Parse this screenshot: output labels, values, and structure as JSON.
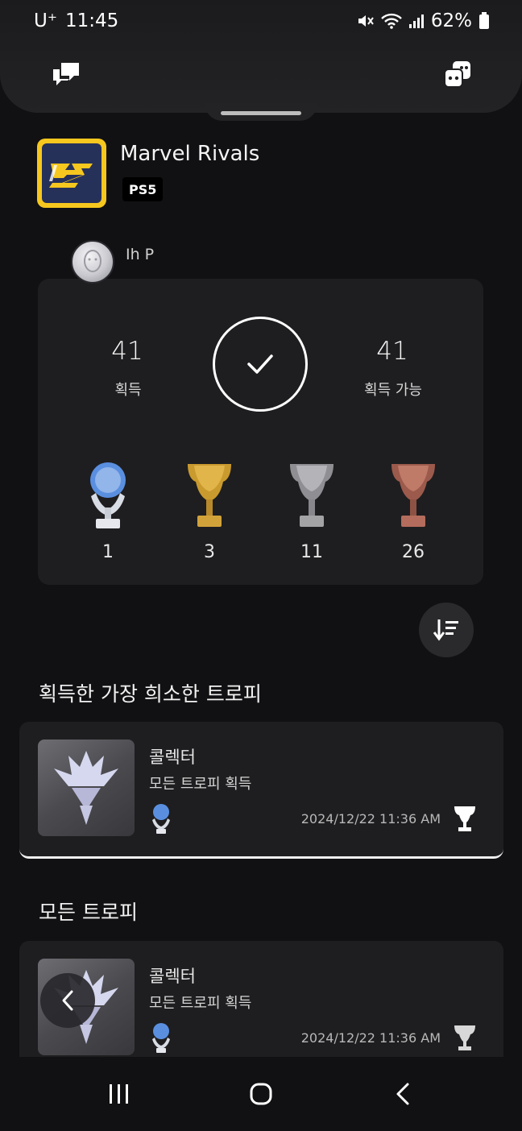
{
  "status_bar": {
    "carrier": "U⁺",
    "time": "11:45",
    "battery": "62%",
    "icons": [
      "mute-icon",
      "wifi-icon",
      "signal-icon",
      "battery-icon"
    ]
  },
  "top_panel": {
    "left_icon": "chat-bubbles-icon",
    "right_icon": "game-controllers-icon"
  },
  "game": {
    "title": "Marvel Rivals",
    "platform": "PS5",
    "icon_colors": {
      "frame": "#f6c71e",
      "background": "#26315a"
    }
  },
  "user": {
    "name": "Ih P"
  },
  "summary": {
    "earned_count": "41",
    "earned_label": "획득",
    "available_count": "41",
    "available_label": "획득 가능",
    "completion_icon": "checkmark-icon"
  },
  "trophy_counts": [
    {
      "grade": "platinum",
      "count": "1",
      "color": "#a9c4ee"
    },
    {
      "grade": "gold",
      "count": "3",
      "color": "#c99a2e"
    },
    {
      "grade": "silver",
      "count": "11",
      "color": "#a3a3a6"
    },
    {
      "grade": "bronze",
      "count": "26",
      "color": "#b46c5c"
    }
  ],
  "sort_button": {
    "icon": "sort-descending-icon"
  },
  "rarest_section": {
    "title": "획득한 가장 희소한 트로피",
    "trophy": {
      "name": "콜렉터",
      "description": "모든 트로피 획득",
      "grade": "platinum",
      "date": "2024/12/22  11:36 AM",
      "earned_icon": "trophy-earned-icon"
    }
  },
  "all_section": {
    "title": "모든 트로피",
    "trophies": [
      {
        "name": "콜렉터",
        "description": "모든 트로피 획득",
        "grade": "platinum",
        "date": "2024/12/22  11:36 AM",
        "earned_icon": "trophy-earned-icon"
      }
    ]
  },
  "floating_back": {
    "icon": "chevron-left-icon"
  },
  "nav_bar": {
    "buttons": [
      "recent-apps-icon",
      "home-icon",
      "back-icon"
    ]
  }
}
